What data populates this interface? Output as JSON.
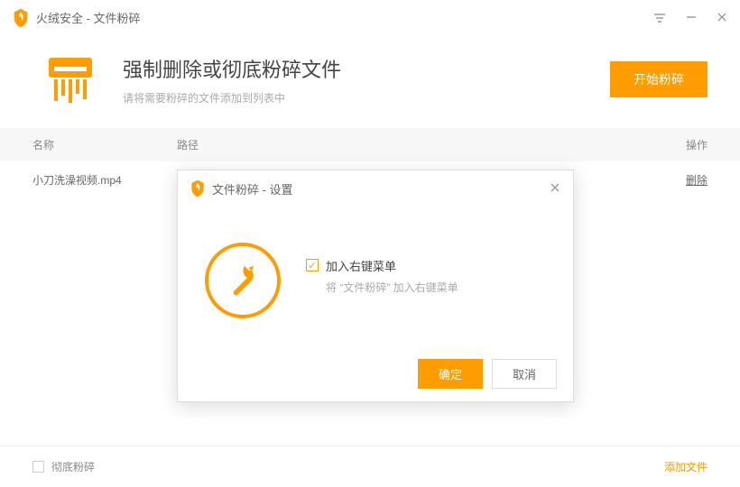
{
  "titlebar": {
    "title": "火绒安全 - 文件粉碎"
  },
  "header": {
    "heading": "强制删除或彻底粉碎文件",
    "sub": "请将需要粉碎的文件添加到列表中",
    "start_label": "开始粉碎"
  },
  "table": {
    "head": {
      "name": "名称",
      "path": "路径",
      "action": "操作"
    },
    "rows": [
      {
        "name": "小刀洗澡视频.mp4",
        "path": "",
        "action": "删除"
      }
    ]
  },
  "footer": {
    "thorough_label": "彻底粉碎",
    "addfile_label": "添加文件"
  },
  "dialog": {
    "title": "文件粉碎 - 设置",
    "option_label": "加入右键菜单",
    "option_desc": "将 “文件粉碎” 加入右键菜单",
    "ok_label": "确定",
    "cancel_label": "取消"
  },
  "colors": {
    "accent": "#ff9c00"
  }
}
